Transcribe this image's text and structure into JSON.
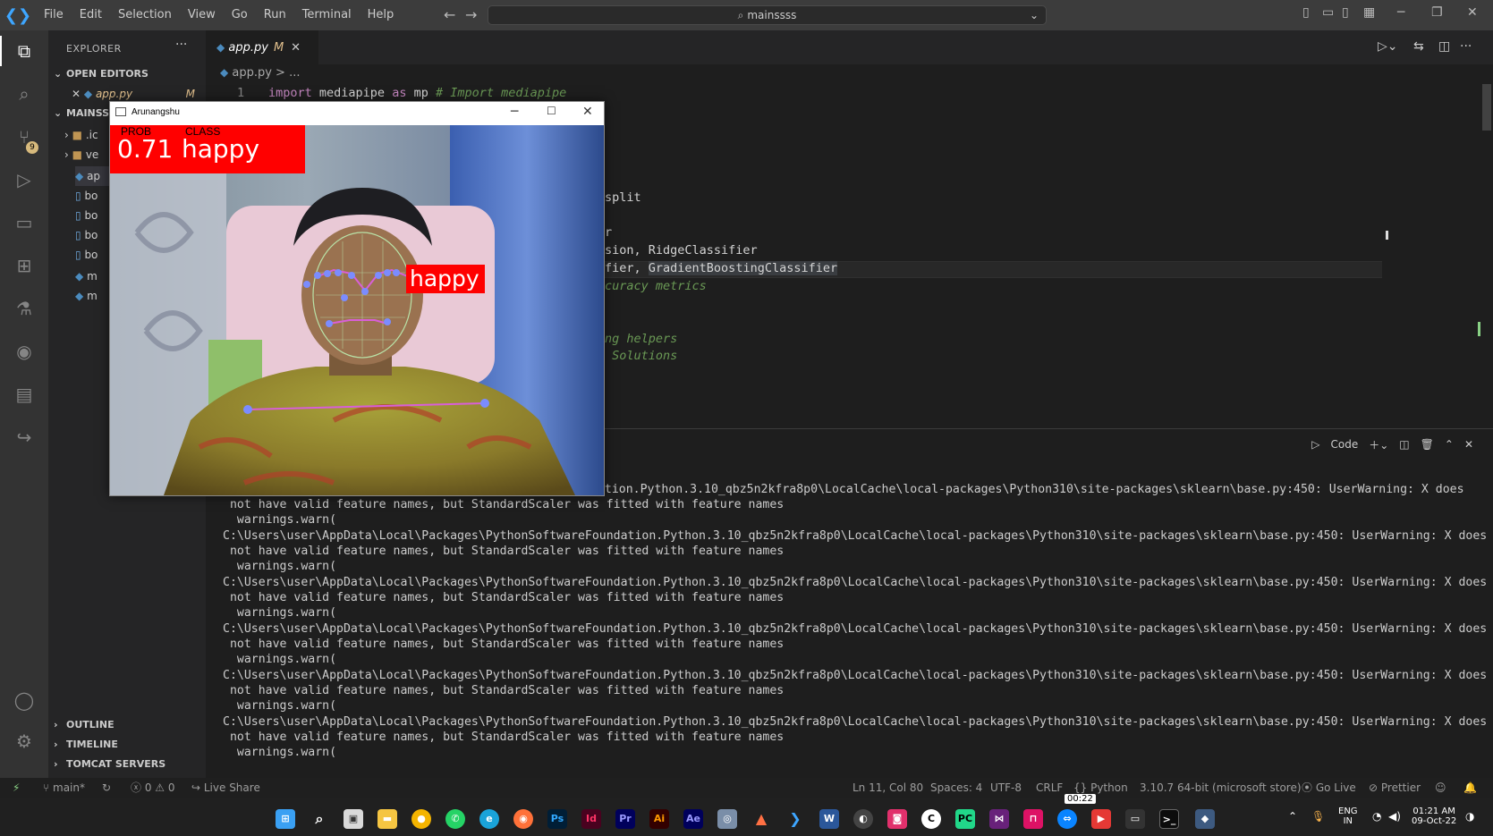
{
  "titlebar": {
    "menus": [
      "File",
      "Edit",
      "Selection",
      "View",
      "Go",
      "Run",
      "Terminal",
      "Help"
    ],
    "search": "mainssss"
  },
  "sidebar": {
    "title": "EXPLORER",
    "open_editors": "OPEN EDITORS",
    "open_file": "app.py",
    "open_file_status": "M",
    "workspace": "MAINSSSS",
    "files": [
      ".ic",
      "ve",
      "ap",
      "bo",
      "bo",
      "bo",
      "bo",
      "m",
      "m"
    ],
    "outline": "OUTLINE",
    "timeline": "TIMELINE",
    "tomcat": "TOMCAT SERVERS",
    "scm_badge": "9"
  },
  "editor": {
    "tab_label": "app.py",
    "tab_status": "M",
    "breadcrumb": "app.py > ...",
    "line1_no": "1",
    "line1_kw1": "import",
    "line1_mod": " mediapipe ",
    "line1_kw2": "as",
    "line1_alias": " mp ",
    "line1_comment": "# Import mediapipe",
    "frag_split": "split",
    "frag_r": "r",
    "frag_sion": "sion, RidgeClassifier",
    "frag_fier": "fier, ",
    "frag_gbc": "GradientBoostingClassifier",
    "frag_metrics": "curacy metrics",
    "frag_helpers": "ng helpers",
    "frag_solutions": " Solutions"
  },
  "panel": {
    "code_label": "Code",
    "first_line": "dation.Python.3.10_qbz5n2kfra8p0\\LocalCache\\local-packages\\Python310\\site-packages\\sklearn\\base.py:450: UserWarning: X does",
    "warn_path": "C:\\Users\\user\\AppData\\Local\\Packages\\PythonSoftwareFoundation.Python.3.10_qbz5n2kfra8p0\\LocalCache\\local-packages\\Python310\\site-packages\\sklearn\\base.py:450: UserWarning: X does",
    "warn_msg": " not have valid feature names, but StandardScaler was fitted with feature names",
    "warn_call": "  warnings.warn("
  },
  "statusbar": {
    "branch": "main*",
    "errors": "0",
    "warnings": "0",
    "liveshare": "Live Share",
    "position": "Ln 11, Col 80",
    "spaces": "Spaces: 4",
    "encoding": "UTF-8",
    "eol": "CRLF",
    "language": "Python",
    "interpreter": "3.10.7 64-bit (microsoft store)",
    "golive": "Go Live",
    "prettier": "Prettier"
  },
  "camera": {
    "window_title": "Arunangshu",
    "prob_label": "PROB",
    "class_label": "CLASS",
    "prob_value": "0.71",
    "class_value": "happy",
    "face_label": "happy"
  },
  "taskbar": {
    "lang": "ENG",
    "region": "IN",
    "time": "01:21 AM",
    "date": "09-Oct-22",
    "timer": "00:22",
    "apps": [
      "Ps",
      "Id",
      "Pr",
      "Ai",
      "Ae",
      "W"
    ]
  },
  "colors": {
    "accent": "#007acc",
    "label_red": "#ff0000",
    "landmark": "#7b8cff",
    "pose_line": "#d85fd8"
  }
}
